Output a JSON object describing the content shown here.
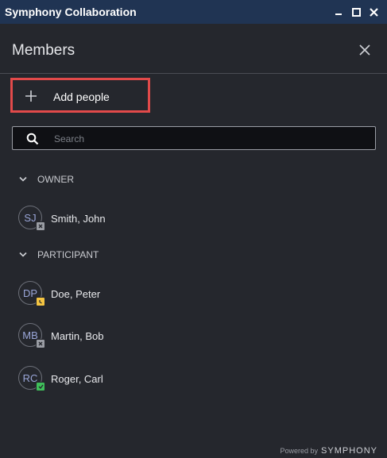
{
  "window": {
    "title": "Symphony Collaboration",
    "controls": [
      "minimize-icon",
      "maximize-icon",
      "close-icon"
    ]
  },
  "panel": {
    "title": "Members",
    "close_icon": "close-icon"
  },
  "add_people": {
    "label": "Add people",
    "icon": "plus-icon",
    "highlight_color": "#e24a4a"
  },
  "search": {
    "placeholder": "Search",
    "value": "",
    "icon": "search-icon"
  },
  "groups": {
    "owner": {
      "label": "OWNER",
      "members": [
        {
          "initials": "SJ",
          "name": "Smith, John",
          "presence": "offline"
        }
      ]
    },
    "participant": {
      "label": "PARTICIPANT",
      "members": [
        {
          "initials": "DP",
          "name": "Doe, Peter",
          "presence": "away"
        },
        {
          "initials": "MB",
          "name": "Martin, Bob",
          "presence": "offline"
        },
        {
          "initials": "RC",
          "name": "Roger, Carl",
          "presence": "available"
        }
      ]
    }
  },
  "presence_colors": {
    "offline": "#9a9da4",
    "away": "#f5c542",
    "available": "#3fbf5a"
  },
  "footer": {
    "powered_by": "Powered by",
    "brand": "SYMPHONY"
  }
}
